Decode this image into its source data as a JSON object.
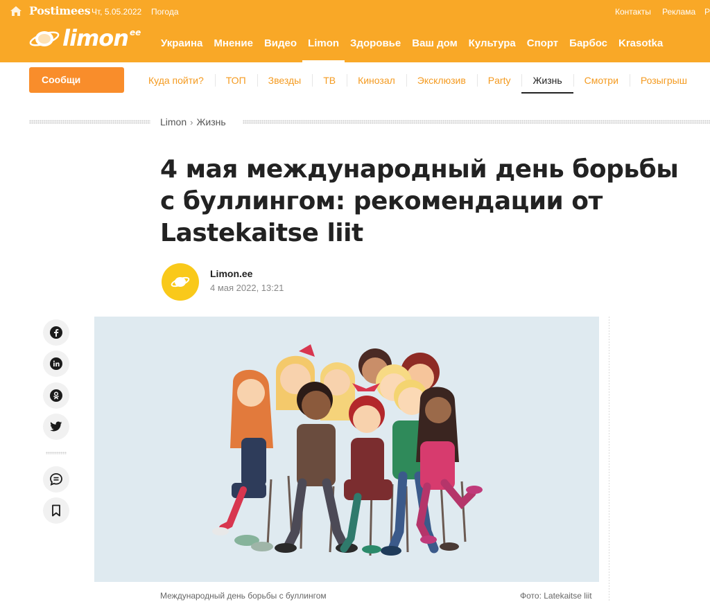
{
  "topbar": {
    "brand": "Postimees",
    "date": "Чт, 5.05.2022",
    "weather": "Погода",
    "contacts": "Контакты",
    "ads": "Реклама",
    "more": "Po"
  },
  "logo": {
    "text": "limon",
    "suffix": "ee"
  },
  "main_nav": [
    "Украина",
    "Мнение",
    "Видео",
    "Limon",
    "Здоровье",
    "Ваш дом",
    "Культура",
    "Спорт",
    "Барбос",
    "Krasotka"
  ],
  "main_nav_active": "Limon",
  "cta_button": "Сообщи",
  "sub_nav": [
    "Куда пойти?",
    "ТОП",
    "Звезды",
    "ТВ",
    "Кинозал",
    "Эксклюзив",
    "Party",
    "Жизнь",
    "Смотри",
    "Розыгрыш"
  ],
  "sub_nav_active": "Жизнь",
  "breadcrumb": {
    "root": "Limon",
    "current": "Жизнь"
  },
  "article": {
    "title": "4 мая международный день борьбы с буллингом: рекомендации от Lastekaitse liit",
    "author": "Limon.ee",
    "date": "4 мая 2022, 13:21",
    "caption": "Международный день борьбы с буллингом",
    "photo_credit": "Фото: Latekaitse liit"
  },
  "share_icons": [
    "facebook-icon",
    "linkedin-icon",
    "odnoklassniki-icon",
    "twitter-icon",
    "comments-icon",
    "bookmark-icon"
  ],
  "colors": {
    "header": "#f9a827",
    "cta": "#f98d2b",
    "subnav_text": "#f49a1f",
    "avatar": "#f9c91a",
    "hero_bg": "#dfeaf0"
  }
}
